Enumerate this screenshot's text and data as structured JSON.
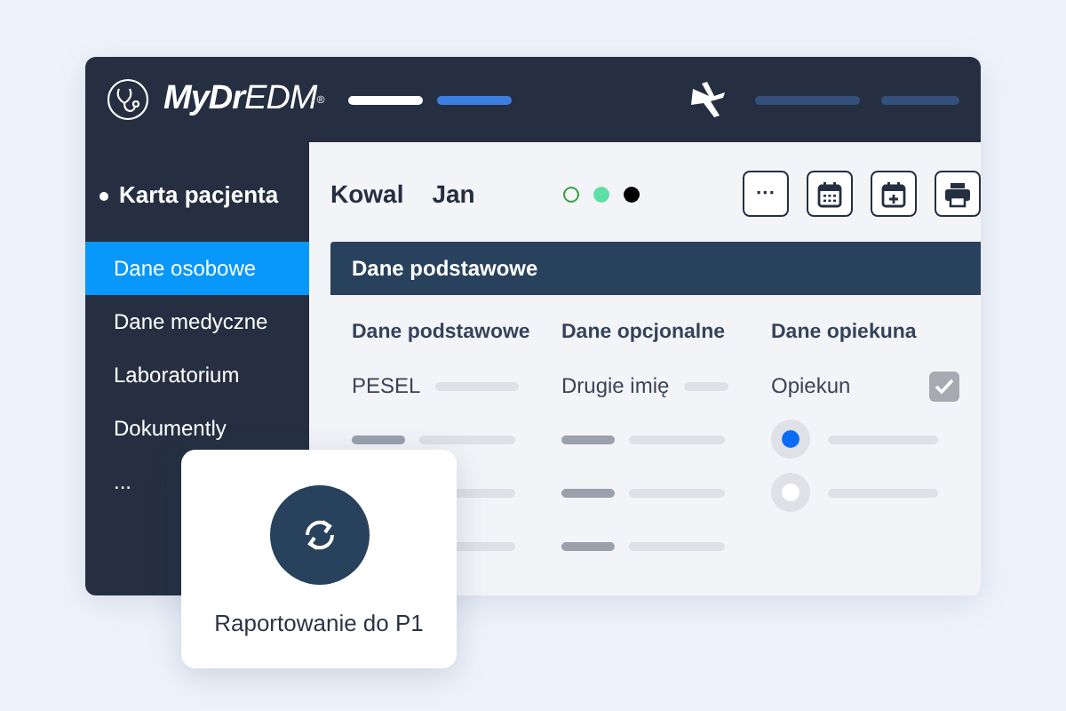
{
  "header": {
    "logo": "**MyDr**EDM$^{®}$"
  },
  "sidebar": {
    "section": "Karta pacjenta",
    "items": [
      {
        "label": "Dane osobowe",
        "selected": true
      },
      {
        "label": "Dane medyczne",
        "selected": false
      },
      {
        "label": "Laboratorium",
        "selected": false
      },
      {
        "label": "Dokumently",
        "selected": false
      },
      {
        "label": "...",
        "selected": false
      }
    ]
  },
  "patient": {
    "last_name": "Kowal",
    "first_name": "Jan",
    "status_dots": [
      {
        "kind": "outline",
        "color": "#2e9e3a"
      },
      {
        "kind": "filled",
        "color": "#5de0a5"
      },
      {
        "kind": "filled",
        "color": "#000000"
      }
    ]
  },
  "toolbar": [
    {
      "kind": "more",
      "label": "···"
    },
    {
      "kind": "calendar"
    },
    {
      "kind": "calendar-add"
    },
    {
      "kind": "print"
    }
  ],
  "panel": {
    "title": "Dane podstawowe",
    "columns": [
      {
        "heading": "Dane podstawowe",
        "rows": [
          {
            "kind": "field",
            "label": "PESEL"
          },
          {
            "kind": "skeleton"
          },
          {
            "kind": "skeleton"
          },
          {
            "kind": "skeleton"
          }
        ]
      },
      {
        "heading": "Dane opcjonalne",
        "rows": [
          {
            "kind": "field",
            "label": "Drugie imię"
          },
          {
            "kind": "skeleton"
          },
          {
            "kind": "skeleton"
          },
          {
            "kind": "skeleton"
          }
        ]
      },
      {
        "heading": "Dane opiekuna",
        "rows": [
          {
            "kind": "checkbox",
            "label": "Opiekun",
            "checked": true
          },
          {
            "kind": "radio",
            "selected": true
          },
          {
            "kind": "radio",
            "selected": false
          }
        ]
      }
    ]
  },
  "popup": {
    "label": "Raportowanie do P1"
  }
}
